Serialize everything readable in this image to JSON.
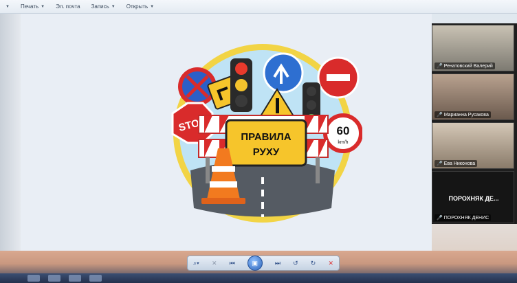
{
  "menu": {
    "items": [
      {
        "label": "Печать"
      },
      {
        "label": "Эл. почта"
      },
      {
        "label": "Запись"
      },
      {
        "label": "Открыть"
      }
    ]
  },
  "slide": {
    "sign_text": [
      "ПРАВИЛА",
      "РУХУ"
    ],
    "stop_text": "STOP",
    "speed_value": "60",
    "speed_unit": "km/h"
  },
  "video": {
    "participants": [
      {
        "name": "Ренатовский Валерий"
      },
      {
        "name": "Марианна Русакова"
      },
      {
        "name": "Ева Никонова"
      }
    ],
    "presenter_big_name": "ПОРОХНЯК ДЕ...",
    "presenter_name": "ПОРОХНЯК ДЕНИС"
  },
  "colors": {
    "mic_muted": "#e04848",
    "accent_blue": "#2c63b8",
    "sign_yellow": "#f6c52b",
    "stop_red": "#d92b2b"
  },
  "icons": {
    "zoom": "magnifier-icon",
    "delete_small": "close-icon",
    "prev": "previous-icon",
    "slideshow": "slideshow-icon",
    "next": "next-icon",
    "rotate_ccw": "rotate-left-icon",
    "rotate_cw": "rotate-right-icon",
    "delete": "delete-icon",
    "mic": "mic-muted-icon"
  }
}
